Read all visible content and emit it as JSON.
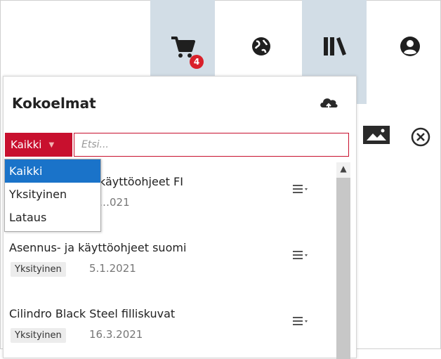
{
  "topbar": {
    "cart_badge": "4",
    "icons": [
      "cart-icon",
      "globe-icon",
      "library-icon",
      "user-icon"
    ],
    "active_color": "#d2dde6"
  },
  "panel": {
    "title": "Kokoelmat",
    "filter": {
      "selected": "Kaikki",
      "options": [
        "Kaikki",
        "Yksityinen",
        "Lataus"
      ]
    },
    "search": {
      "placeholder": "Etsi..."
    },
    "items": [
      {
        "title": "käyttöohjeet FI",
        "date": "…021"
      },
      {
        "title": "Asennus- ja käyttöohjeet suomi",
        "tag": "Yksityinen",
        "date": "5.1.2021"
      },
      {
        "title": "Cilindro Black Steel filliskuvat",
        "tag": "Yksityinen",
        "date": "16.3.2021"
      }
    ]
  },
  "colors": {
    "accent": "#c8102e",
    "selected_option": "#1a73c9",
    "badge": "#d9202a"
  }
}
